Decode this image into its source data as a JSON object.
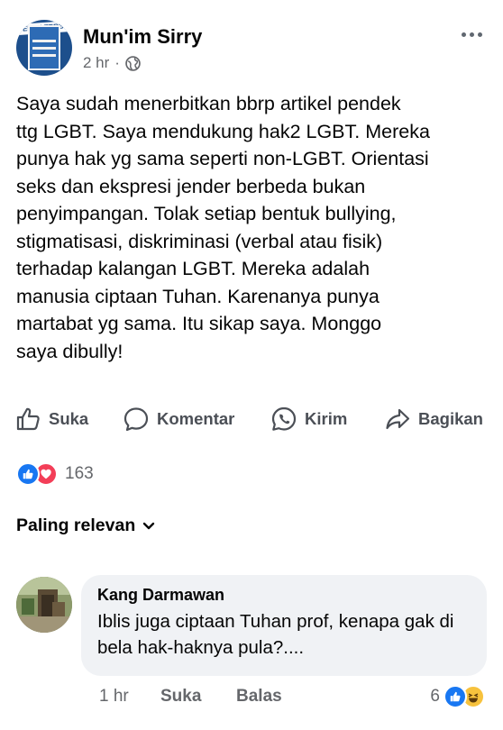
{
  "post": {
    "author": "Mun'im Sirry",
    "time": "2 hr",
    "separator": "·",
    "privacy_icon": "globe-icon",
    "avatar_badge": "TELAH TERBIT",
    "text": "Saya sudah menerbitkan bbrp artikel pendek\nttg LGBT. Saya mendukung hak2 LGBT. Mereka\npunya hak yg sama seperti non-LGBT. Orientasi\nseks dan ekspresi jender berbeda bukan\npenyimpangan. Tolak setiap bentuk bullying,\nstigmatisasi, diskriminasi (verbal atau fisik)\nterhadap kalangan LGBT. Mereka adalah\nmanusia ciptaan Tuhan. Karenanya punya\nmartabat yg sama. Itu sikap saya. Monggo\nsaya dibully!"
  },
  "actions": {
    "like": "Suka",
    "comment": "Komentar",
    "send": "Kirim",
    "share": "Bagikan"
  },
  "reactions": {
    "count": "163",
    "types": [
      "like",
      "love"
    ]
  },
  "comments_sort": "Paling relevan",
  "comment": {
    "author": "Kang Darmawan",
    "text": "Iblis juga ciptaan Tuhan prof, kenapa gak di bela hak-haknya pula?....",
    "time": "1 hr",
    "like_label": "Suka",
    "reply_label": "Balas",
    "reaction_count": "6",
    "reaction_types": [
      "like",
      "haha"
    ]
  },
  "colors": {
    "like_blue": "#1877f2",
    "love_red": "#f33e58",
    "haha_yellow": "#f7c23d",
    "secondary_text": "#65676b",
    "bubble_bg": "#f0f2f5"
  }
}
